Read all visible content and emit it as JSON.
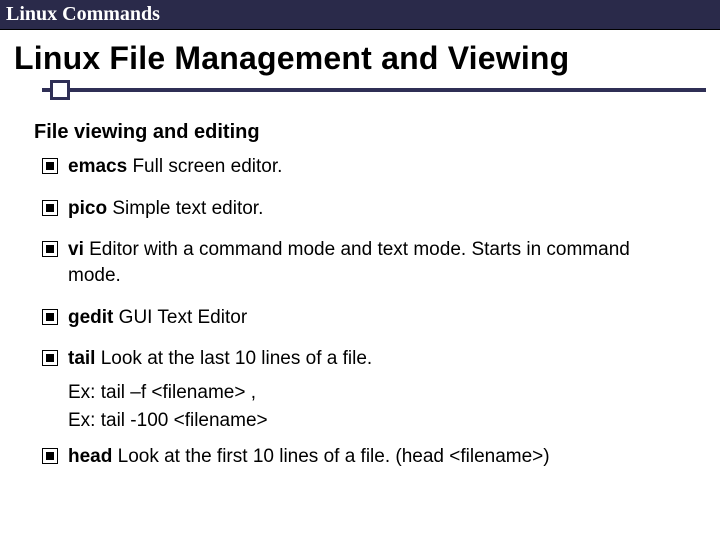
{
  "header": {
    "title": "Linux Commands"
  },
  "slide": {
    "title": "Linux File Management and Viewing",
    "section": "File viewing and editing",
    "items": [
      {
        "cmd": "emacs",
        "desc": " Full screen editor."
      },
      {
        "cmd": "pico",
        "desc": " Simple text editor."
      },
      {
        "cmd": "vi",
        "desc": " Editor with a command mode and text mode. Starts in command mode."
      },
      {
        "cmd": "gedit",
        "desc": " GUI Text Editor"
      },
      {
        "cmd": "tail",
        "desc": " Look at the last 10 lines of a file.",
        "ex": [
          "Ex: tail –f <filename> ,",
          "Ex: tail -100 <filename>"
        ]
      },
      {
        "cmd": "head",
        "desc": " Look at the first 10 lines of a file. (head <filename>)"
      }
    ]
  }
}
